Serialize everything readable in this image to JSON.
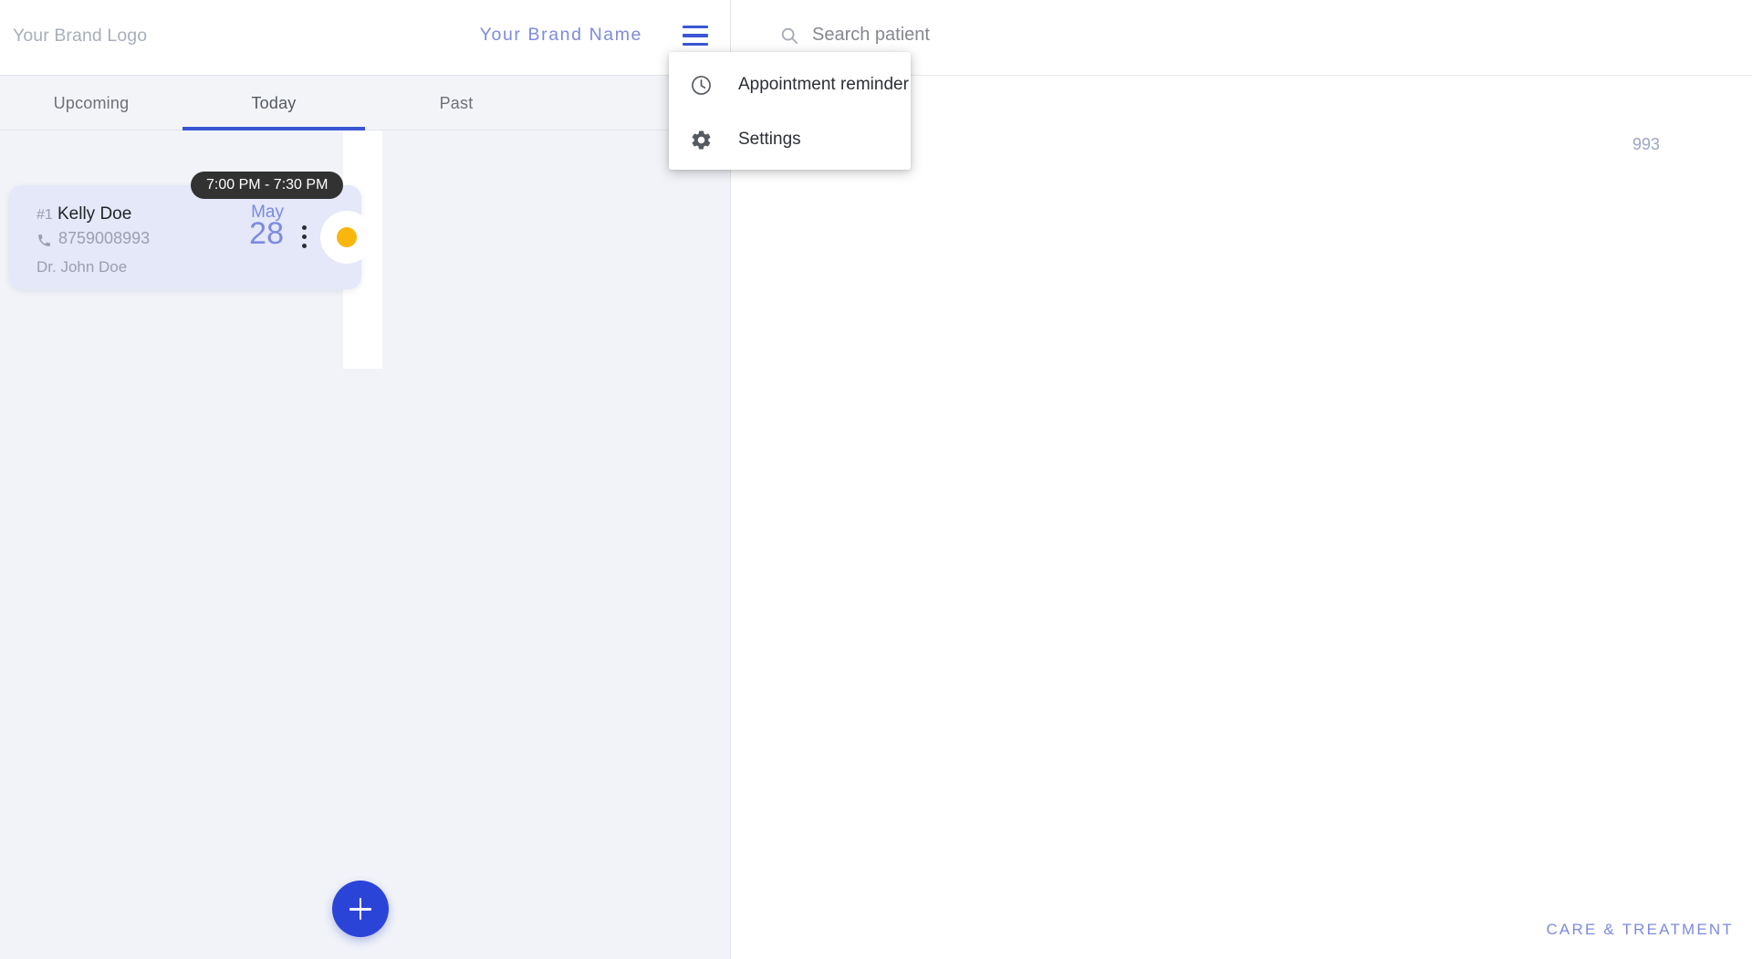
{
  "header": {
    "brand_logo": "Your Brand Logo",
    "brand_name": "Your Brand Name",
    "menu_icon": "hamburger-icon"
  },
  "tabs": [
    {
      "label": "Upcoming",
      "active": false
    },
    {
      "label": "Today",
      "active": true
    },
    {
      "label": "Past",
      "active": false
    }
  ],
  "appointments": [
    {
      "index": "#1",
      "patient": "Kelly Doe",
      "phone": "8759008993",
      "doctor": "Dr. John Doe",
      "time_range": "7:00 PM - 7:30 PM",
      "month": "May",
      "day": "28",
      "status_color": "#f9b70d"
    }
  ],
  "search": {
    "placeholder": "Search patient",
    "icon": "search-icon"
  },
  "right_panel": {
    "partial_phone": "993",
    "footer_label": "CARE & TREATMENT"
  },
  "menu": {
    "items": [
      {
        "label": "Appointment reminder",
        "icon": "clock-icon"
      },
      {
        "label": "Settings",
        "icon": "gear-icon"
      }
    ]
  },
  "fab": {
    "left_label": "+",
    "right_label": "+",
    "color": "#2b44d8"
  },
  "colors": {
    "accent_blue": "#2b44d8",
    "brand_periwinkle": "#7d8ae0",
    "card_background": "#e4e8f8",
    "pane_background": "#f1f3f8",
    "status_yellow": "#f9b70d",
    "pill_dark": "#323232"
  }
}
